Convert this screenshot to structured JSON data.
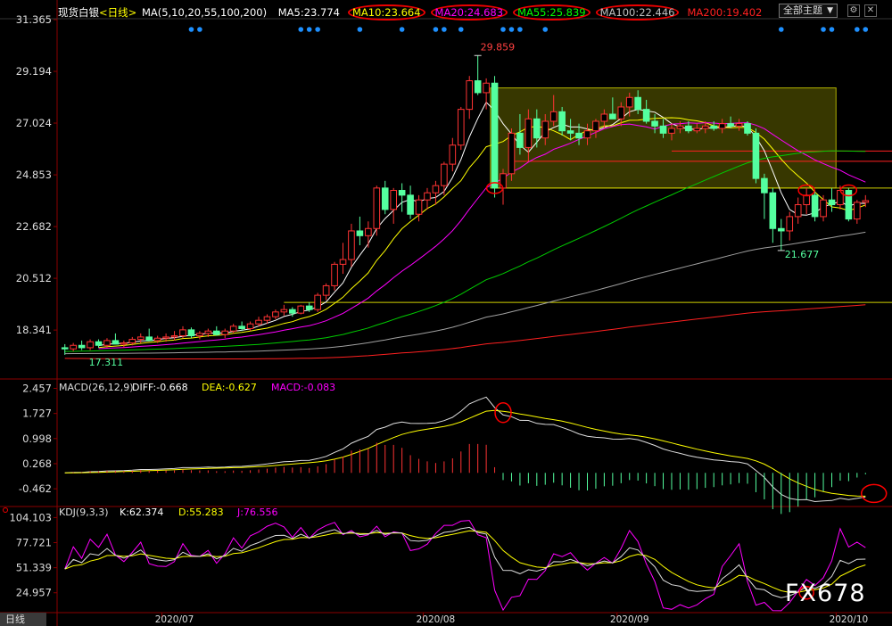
{
  "header": {
    "instrument": "现货白银",
    "period": "<日线>",
    "ma_params": "MA(5,10,20,55,100,200)",
    "ma_values": [
      {
        "label": "MA5:23.774",
        "color": "#ffffff"
      },
      {
        "label": "MA10:23.664",
        "color": "#ffff00",
        "circled": true
      },
      {
        "label": "MA20:24.683",
        "color": "#ff00ff",
        "circled": true
      },
      {
        "label": "MA55:25.839",
        "color": "#00ff00",
        "circled": true
      },
      {
        "label": "MA100:22.446",
        "color": "#c0c0c0",
        "circled": true
      },
      {
        "label": "MA200:19.402",
        "color": "#ff2020"
      }
    ],
    "theme_select": "全部主题",
    "caret": "▼",
    "btn_settings": "⚙",
    "btn_close": "✕"
  },
  "colors": {
    "up": "#ff3333",
    "down": "#54ff9f",
    "ma5": "#ffffff",
    "ma10": "#ffff00",
    "ma20": "#ff00ff",
    "ma55": "#00cc00",
    "ma100": "#a0a0a0",
    "ma200": "#ff2020",
    "axis": "#8b0000",
    "text_red": "#ff4040",
    "text_green": "#54ff9f",
    "dot": "#1e90ff",
    "circle": "#ff0000"
  },
  "chart_data": [
    {
      "type": "candlestick",
      "title": "现货白银 日线",
      "y_ticks": [
        "31.365",
        "29.194",
        "27.024",
        "24.853",
        "22.682",
        "20.512",
        "18.341"
      ],
      "ylim": [
        16.4,
        31.365
      ],
      "x_ticks": [
        "2020/07",
        "2020/08",
        "2020/09",
        "2020/10"
      ],
      "annotations": {
        "high": "29.859",
        "low": "21.677",
        "start_low": "17.311"
      },
      "ohlc": [
        [
          17.6,
          17.75,
          17.3,
          17.55
        ],
        [
          17.55,
          17.8,
          17.45,
          17.7
        ],
        [
          17.7,
          17.9,
          17.5,
          17.6
        ],
        [
          17.6,
          17.95,
          17.5,
          17.85
        ],
        [
          17.85,
          17.95,
          17.6,
          17.7
        ],
        [
          17.7,
          18.0,
          17.6,
          17.9
        ],
        [
          17.9,
          18.2,
          17.8,
          17.75
        ],
        [
          17.75,
          17.9,
          17.6,
          17.8
        ],
        [
          17.8,
          18.05,
          17.7,
          17.95
        ],
        [
          17.95,
          18.2,
          17.8,
          18.05
        ],
        [
          18.05,
          18.4,
          17.9,
          17.9
        ],
        [
          17.9,
          18.1,
          17.8,
          18.0
        ],
        [
          18.0,
          18.2,
          17.85,
          18.05
        ],
        [
          18.05,
          18.3,
          17.9,
          18.1
        ],
        [
          18.1,
          18.5,
          18.0,
          18.35
        ],
        [
          18.35,
          18.45,
          18.0,
          18.1
        ],
        [
          18.1,
          18.3,
          17.95,
          18.2
        ],
        [
          18.2,
          18.4,
          18.05,
          18.3
        ],
        [
          18.3,
          18.5,
          18.1,
          18.15
        ],
        [
          18.15,
          18.4,
          18.0,
          18.3
        ],
        [
          18.3,
          18.6,
          18.2,
          18.5
        ],
        [
          18.5,
          18.7,
          18.3,
          18.4
        ],
        [
          18.4,
          18.7,
          18.3,
          18.6
        ],
        [
          18.6,
          18.9,
          18.5,
          18.75
        ],
        [
          18.75,
          19.0,
          18.6,
          18.9
        ],
        [
          18.9,
          19.2,
          18.8,
          19.1
        ],
        [
          19.1,
          19.4,
          18.95,
          19.2
        ],
        [
          19.2,
          19.3,
          18.9,
          19.05
        ],
        [
          19.05,
          19.4,
          19.0,
          19.35
        ],
        [
          19.35,
          19.5,
          19.1,
          19.2
        ],
        [
          19.2,
          19.9,
          19.1,
          19.8
        ],
        [
          19.8,
          20.3,
          19.6,
          20.2
        ],
        [
          20.2,
          21.2,
          20.0,
          21.1
        ],
        [
          21.1,
          22.0,
          20.7,
          21.3
        ],
        [
          21.3,
          22.8,
          21.0,
          22.5
        ],
        [
          22.5,
          23.1,
          21.9,
          22.3
        ],
        [
          22.3,
          22.9,
          21.8,
          22.6
        ],
        [
          22.6,
          24.4,
          22.3,
          24.3
        ],
        [
          24.3,
          24.6,
          23.2,
          23.4
        ],
        [
          23.4,
          24.3,
          22.8,
          24.2
        ],
        [
          24.2,
          24.5,
          23.3,
          24.0
        ],
        [
          24.0,
          24.4,
          23.0,
          23.2
        ],
        [
          23.2,
          24.0,
          22.9,
          23.8
        ],
        [
          23.8,
          24.3,
          23.4,
          24.1
        ],
        [
          24.1,
          24.6,
          23.6,
          24.4
        ],
        [
          24.4,
          25.4,
          24.0,
          25.3
        ],
        [
          25.3,
          26.4,
          25.0,
          26.1
        ],
        [
          26.1,
          27.7,
          25.9,
          27.6
        ],
        [
          27.6,
          29.0,
          27.2,
          28.8
        ],
        [
          28.8,
          29.859,
          28.2,
          28.3
        ],
        [
          28.3,
          28.9,
          27.6,
          28.7
        ],
        [
          28.7,
          29.0,
          23.9,
          24.3
        ],
        [
          24.3,
          25.1,
          23.6,
          24.9
        ],
        [
          24.9,
          26.8,
          24.6,
          26.6
        ],
        [
          26.6,
          27.4,
          25.7,
          26.0
        ],
        [
          26.0,
          27.6,
          25.4,
          27.2
        ],
        [
          27.2,
          27.6,
          26.0,
          26.4
        ],
        [
          26.4,
          27.4,
          26.1,
          27.1
        ],
        [
          27.1,
          28.2,
          26.9,
          27.5
        ],
        [
          27.5,
          27.7,
          26.5,
          26.7
        ],
        [
          26.7,
          27.2,
          26.3,
          26.6
        ],
        [
          26.6,
          27.0,
          26.1,
          26.4
        ],
        [
          26.4,
          27.0,
          26.1,
          26.7
        ],
        [
          26.7,
          27.2,
          26.4,
          27.1
        ],
        [
          27.1,
          27.6,
          26.8,
          27.4
        ],
        [
          27.4,
          28.1,
          27.2,
          27.2
        ],
        [
          27.2,
          27.9,
          26.9,
          27.7
        ],
        [
          27.7,
          28.3,
          27.3,
          28.1
        ],
        [
          28.1,
          28.4,
          27.4,
          27.6
        ],
        [
          27.6,
          28.0,
          27.0,
          27.1
        ],
        [
          27.1,
          27.4,
          26.6,
          26.9
        ],
        [
          26.9,
          27.2,
          26.4,
          26.6
        ],
        [
          26.6,
          27.0,
          26.3,
          26.8
        ],
        [
          26.8,
          27.1,
          26.6,
          26.9
        ],
        [
          26.9,
          27.1,
          26.6,
          26.7
        ],
        [
          26.7,
          27.0,
          26.6,
          26.8
        ],
        [
          26.8,
          27.1,
          26.6,
          26.9
        ],
        [
          26.9,
          27.1,
          26.7,
          26.8
        ],
        [
          26.8,
          27.2,
          26.6,
          27.0
        ],
        [
          27.0,
          27.3,
          26.8,
          26.9
        ],
        [
          26.9,
          27.2,
          26.7,
          27.0
        ],
        [
          27.0,
          27.1,
          26.5,
          26.6
        ],
        [
          26.6,
          26.8,
          24.5,
          24.7
        ],
        [
          24.7,
          24.9,
          23.0,
          24.1
        ],
        [
          24.1,
          24.3,
          22.0,
          22.6
        ],
        [
          22.6,
          23.0,
          21.677,
          22.5
        ],
        [
          22.5,
          23.3,
          22.1,
          23.1
        ],
        [
          23.1,
          23.9,
          22.8,
          23.6
        ],
        [
          23.6,
          24.3,
          23.2,
          24.0
        ],
        [
          24.0,
          24.2,
          22.9,
          23.1
        ],
        [
          23.1,
          24.0,
          22.9,
          23.8
        ],
        [
          23.8,
          24.3,
          23.3,
          23.6
        ],
        [
          23.6,
          24.4,
          23.4,
          24.2
        ],
        [
          24.2,
          24.3,
          22.9,
          23.0
        ],
        [
          23.0,
          23.8,
          22.8,
          23.7
        ],
        [
          23.7,
          24.0,
          23.5,
          23.77
        ]
      ],
      "ma_levels_last": {
        "MA5": 23.774,
        "MA10": 23.664,
        "MA20": 24.683,
        "MA55": 25.839,
        "MA100": 22.446,
        "MA200": 19.402
      },
      "box": {
        "x_from": 51,
        "x_to": 92,
        "y_from": 24.3,
        "y_to": 28.5
      },
      "h_lines": [
        {
          "y": 24.3,
          "color": "#d0d000",
          "from": 51
        },
        {
          "y": 25.85,
          "color": "#ff2020",
          "from": 72
        },
        {
          "y": 25.42,
          "color": "#ff2020",
          "from": 53
        },
        {
          "y": 19.5,
          "color": "#d0d000",
          "from": 26
        }
      ]
    },
    {
      "type": "macd",
      "title": "MACD(26,12,9)",
      "legend": [
        {
          "label": "DIFF:-0.668",
          "color": "#ffffff"
        },
        {
          "label": "DEA:-0.627",
          "color": "#ffff00"
        },
        {
          "label": "MACD:-0.083",
          "color": "#ff00ff"
        }
      ],
      "y_ticks": [
        "2.457",
        "1.727",
        "0.998",
        "0.268",
        "-0.462"
      ],
      "ylim": [
        -0.9,
        2.6
      ]
    },
    {
      "type": "kdj",
      "title": "KDJ(9,3,3)",
      "legend": [
        {
          "label": "K:62.374",
          "color": "#ffffff"
        },
        {
          "label": "D:55.283",
          "color": "#ffff00"
        },
        {
          "label": "J:76.556",
          "color": "#ff00ff"
        }
      ],
      "y_ticks": [
        "104.103",
        "77.721",
        "51.339",
        "24.957"
      ],
      "ylim": [
        5,
        112
      ]
    }
  ],
  "footer": {
    "period_tab": "日线",
    "watermark": "FX678"
  }
}
